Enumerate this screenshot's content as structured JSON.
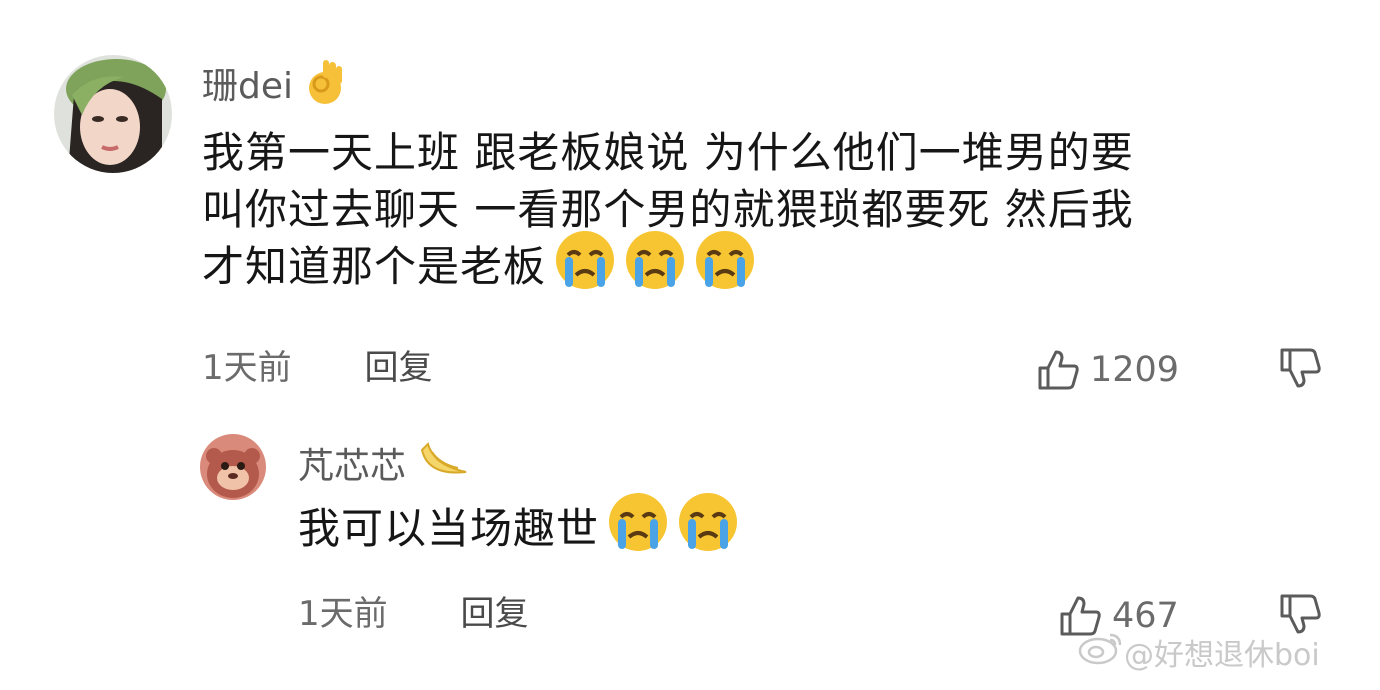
{
  "comments": [
    {
      "username": "珊dei",
      "username_flair_icon": "ok-hand-icon",
      "body_lines": [
        "我第一天上班 跟老板娘说 为什么他们一堆男的要",
        "叫你过去聊天 一看那个男的就猥琐都要死 然后我",
        "才知道那个是老板"
      ],
      "trailing_emoji": [
        "loudly-crying-face-icon",
        "loudly-crying-face-icon",
        "loudly-crying-face-icon"
      ],
      "time": "1天前",
      "reply_label": "回复",
      "like_count": "1209"
    },
    {
      "username": "芃芯芯",
      "username_flair_icon": "banana-flair-icon",
      "body_lines": [
        "我可以当场趣世"
      ],
      "trailing_emoji": [
        "loudly-crying-face-icon",
        "loudly-crying-face-icon"
      ],
      "time": "1天前",
      "reply_label": "回复",
      "like_count": "467"
    }
  ],
  "watermark": "@好想退休boi",
  "colors": {
    "text_primary": "#161616",
    "text_secondary": "#6b6b6b",
    "emoji_face": "#f7c531",
    "emoji_tears": "#4aa3e6"
  }
}
